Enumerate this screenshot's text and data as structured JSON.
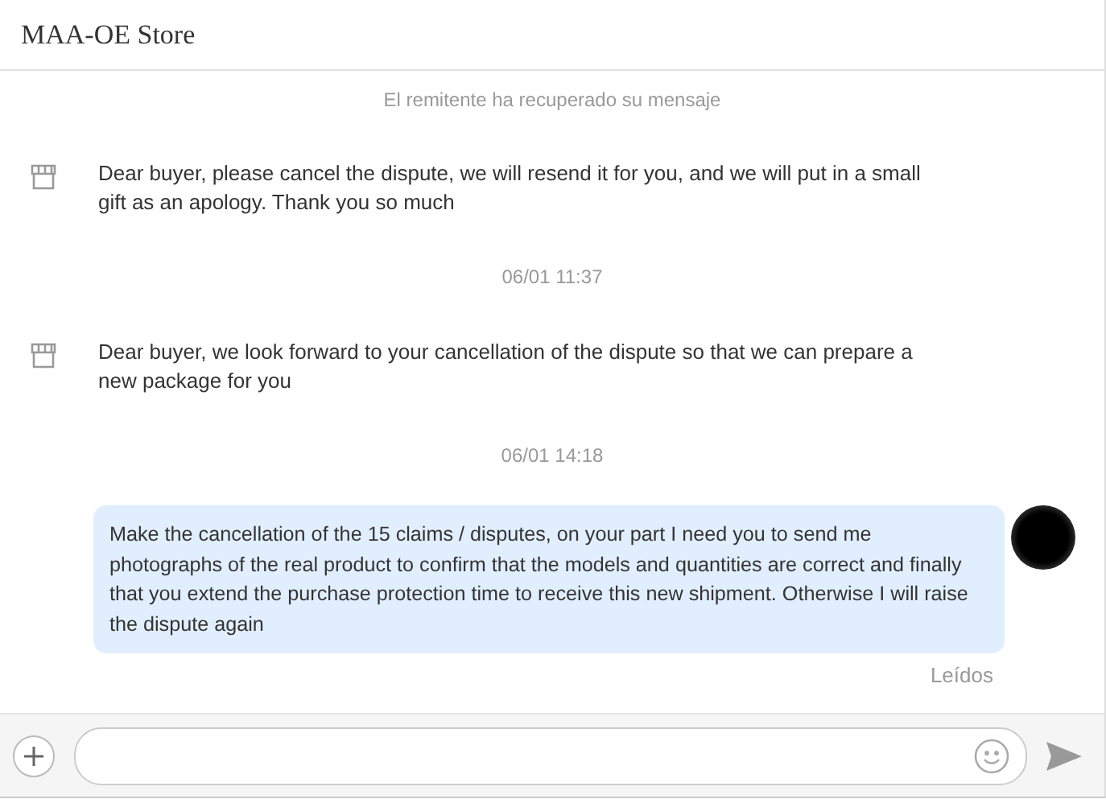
{
  "window": {
    "title": "MAA-OE Store"
  },
  "messages": [
    {
      "kind": "notice",
      "text": "El remitente ha recuperado su mensaje"
    },
    {
      "kind": "seller",
      "text": "Dear buyer, please cancel the dispute, we will resend it for you, and we will put in a small gift as an apology. Thank you so much"
    },
    {
      "kind": "time",
      "text": "06/01 11:37"
    },
    {
      "kind": "seller",
      "text": "Dear buyer, we look forward to your cancellation of the dispute so that we can prepare a new package for you"
    },
    {
      "kind": "time",
      "text": "06/01 14:18"
    },
    {
      "kind": "buyer",
      "text": "Make the cancellation of the 15 claims / disputes, on your part I need you to send me photographs of the real product to confirm that the models and quantities are correct and finally that you extend the purchase protection time to receive this new shipment. Otherwise I will raise the dispute again",
      "status": "Leídos"
    }
  ]
}
